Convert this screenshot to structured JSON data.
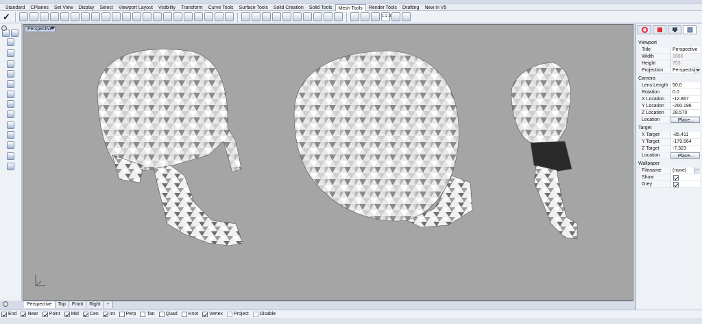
{
  "menu_tabs": [
    "Standard",
    "CPlanes",
    "Set View",
    "Display",
    "Select",
    "Viewport Layout",
    "Visibility",
    "Transform",
    "Curve Tools",
    "Surface Tools",
    "Solid Creation",
    "Solid Tools",
    "Mesh Tools",
    "Render Tools",
    "Drafting",
    "New in V5"
  ],
  "active_menu_tab": "Mesh Tools",
  "toolbar": {
    "num_label": "1.2.3\n1.2.3"
  },
  "viewport": {
    "title": "Perspective"
  },
  "view_tabs": [
    "Perspective",
    "Top",
    "Front",
    "Right"
  ],
  "active_view_tab": "Perspective",
  "osnaps": [
    {
      "label": "End",
      "checked": true
    },
    {
      "label": "Near",
      "checked": true
    },
    {
      "label": "Point",
      "checked": true
    },
    {
      "label": "Mid",
      "checked": true
    },
    {
      "label": "Cen",
      "checked": true
    },
    {
      "label": "Int",
      "checked": true
    },
    {
      "label": "Perp",
      "checked": false
    },
    {
      "label": "Tan",
      "checked": false
    },
    {
      "label": "Quad",
      "checked": false
    },
    {
      "label": "Knot",
      "checked": false
    },
    {
      "label": "Vertex",
      "checked": true
    },
    {
      "label": "Project",
      "checked": false
    },
    {
      "label": "Disable",
      "checked": false
    }
  ],
  "panel": {
    "viewport_section": "Viewport",
    "title_label": "Title",
    "title_value": "Perspective",
    "width_label": "Width",
    "width_value": "1666",
    "height_label": "Height",
    "height_value": "753",
    "projection_label": "Projection",
    "projection_value": "Perspective",
    "camera_section": "Camera",
    "lens_label": "Lens Length",
    "lens_value": "50.0",
    "rotation_label": "Rotation",
    "rotation_value": "0.0",
    "xloc_label": "X Location",
    "xloc_value": "-12.867",
    "yloc_label": "Y Location",
    "yloc_value": "-260.196",
    "zloc_label": "Z Location",
    "zloc_value": "28.570",
    "location_label": "Location",
    "place_label": "Place...",
    "target_section": "Target",
    "xt_label": "X Target",
    "xt_value": "-85.411",
    "yt_label": "Y Target",
    "yt_value": "-179.564",
    "zt_label": "Z Target",
    "zt_value": "-7.323",
    "tlocation_label": "Location",
    "tplace_label": "Place...",
    "wallpaper_section": "Wallpaper",
    "filename_label": "Filename",
    "filename_value": "(none)",
    "show_label": "Show",
    "show_checked": true,
    "grey_label": "Grey",
    "grey_checked": true
  }
}
